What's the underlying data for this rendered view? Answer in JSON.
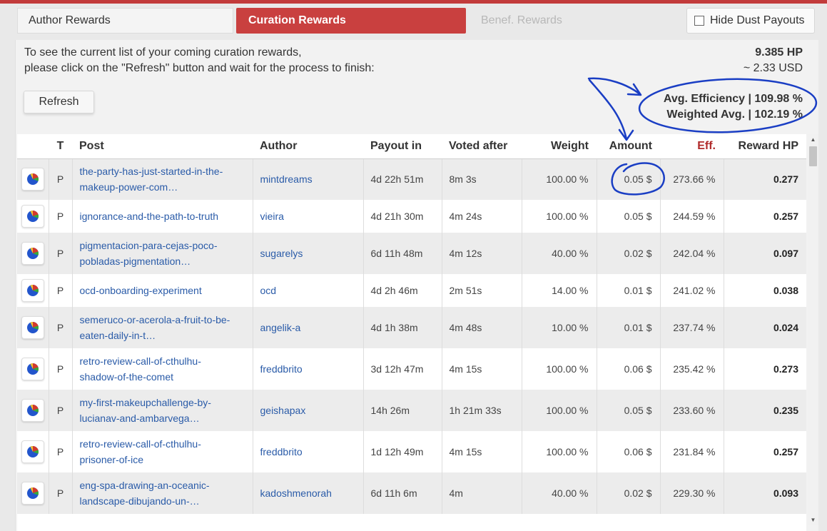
{
  "tabs": {
    "author": "Author Rewards",
    "curation": "Curation Rewards",
    "benef": "Benef. Rewards",
    "hide_dust": "Hide Dust Payouts"
  },
  "info": {
    "line1": "To see the current list of your coming curation rewards,",
    "line2": "please click on the \"Refresh\" button and wait for the process to finish:",
    "hp": "9.385 HP",
    "usd": "~ 2.33 USD",
    "refresh_label": "Refresh",
    "avg_efficiency": "Avg. Efficiency | 109.98 %",
    "weighted_avg": "Weighted Avg. | 102.19 %"
  },
  "table": {
    "headers": {
      "type": "T",
      "post": "Post",
      "author": "Author",
      "payout": "Payout in",
      "voted": "Voted after",
      "weight": "Weight",
      "amount": "Amount",
      "eff": "Eff.",
      "reward": "Reward HP"
    },
    "rows": [
      {
        "type": "P",
        "post1": "the-party-has-just-started-in-the-",
        "post2": "makeup-power-com…",
        "author": "mintdreams",
        "payout": "4d 22h 51m",
        "voted": "8m 3s",
        "weight": "100.00 %",
        "amount": "0.05 $",
        "eff": "273.66 %",
        "reward": "0.277"
      },
      {
        "type": "P",
        "post1": "ignorance-and-the-path-to-truth",
        "post2": "",
        "author": "vieira",
        "payout": "4d 21h 30m",
        "voted": "4m 24s",
        "weight": "100.00 %",
        "amount": "0.05 $",
        "eff": "244.59 %",
        "reward": "0.257"
      },
      {
        "type": "P",
        "post1": "pigmentacion-para-cejas-poco-",
        "post2": "pobladas-pigmentation…",
        "author": "sugarelys",
        "payout": "6d 11h 48m",
        "voted": "4m 12s",
        "weight": "40.00 %",
        "amount": "0.02 $",
        "eff": "242.04 %",
        "reward": "0.097"
      },
      {
        "type": "P",
        "post1": "ocd-onboarding-experiment",
        "post2": "",
        "author": "ocd",
        "payout": "4d 2h 46m",
        "voted": "2m 51s",
        "weight": "14.00 %",
        "amount": "0.01 $",
        "eff": "241.02 %",
        "reward": "0.038"
      },
      {
        "type": "P",
        "post1": "semeruco-or-acerola-a-fruit-to-be-",
        "post2": "eaten-daily-in-t…",
        "author": "angelik-a",
        "payout": "4d 1h 38m",
        "voted": "4m 48s",
        "weight": "10.00 %",
        "amount": "0.01 $",
        "eff": "237.74 %",
        "reward": "0.024"
      },
      {
        "type": "P",
        "post1": "retro-review-call-of-cthulhu-",
        "post2": "shadow-of-the-comet",
        "author": "freddbrito",
        "payout": "3d 12h 47m",
        "voted": "4m 15s",
        "weight": "100.00 %",
        "amount": "0.06 $",
        "eff": "235.42 %",
        "reward": "0.273"
      },
      {
        "type": "P",
        "post1": "my-first-makeupchallenge-by-",
        "post2": "lucianav-and-ambarvega…",
        "author": "geishapax",
        "payout": "14h 26m",
        "voted": "1h 21m 33s",
        "weight": "100.00 %",
        "amount": "0.05 $",
        "eff": "233.60 %",
        "reward": "0.235"
      },
      {
        "type": "P",
        "post1": "retro-review-call-of-cthulhu-",
        "post2": "prisoner-of-ice",
        "author": "freddbrito",
        "payout": "1d 12h 49m",
        "voted": "4m 15s",
        "weight": "100.00 %",
        "amount": "0.06 $",
        "eff": "231.84 %",
        "reward": "0.257"
      },
      {
        "type": "P",
        "post1": "eng-spa-drawing-an-oceanic-",
        "post2": "landscape-dibujando-un-…",
        "author": "kadoshmenorah",
        "payout": "6d 11h 6m",
        "voted": "4m",
        "weight": "40.00 %",
        "amount": "0.02 $",
        "eff": "229.30 %",
        "reward": "0.093"
      }
    ]
  },
  "colors": {
    "accent": "#c9403f",
    "link": "#2a5ba8",
    "annotation": "#1a3ec4",
    "pie_blue": "#2255cc",
    "pie_red": "#d33a2c",
    "pie_green": "#3aaa35",
    "pie_yellow": "#f2c12e"
  },
  "icons": {
    "row_chart": "pie-chart-icon",
    "checkbox": "checkbox-icon"
  }
}
